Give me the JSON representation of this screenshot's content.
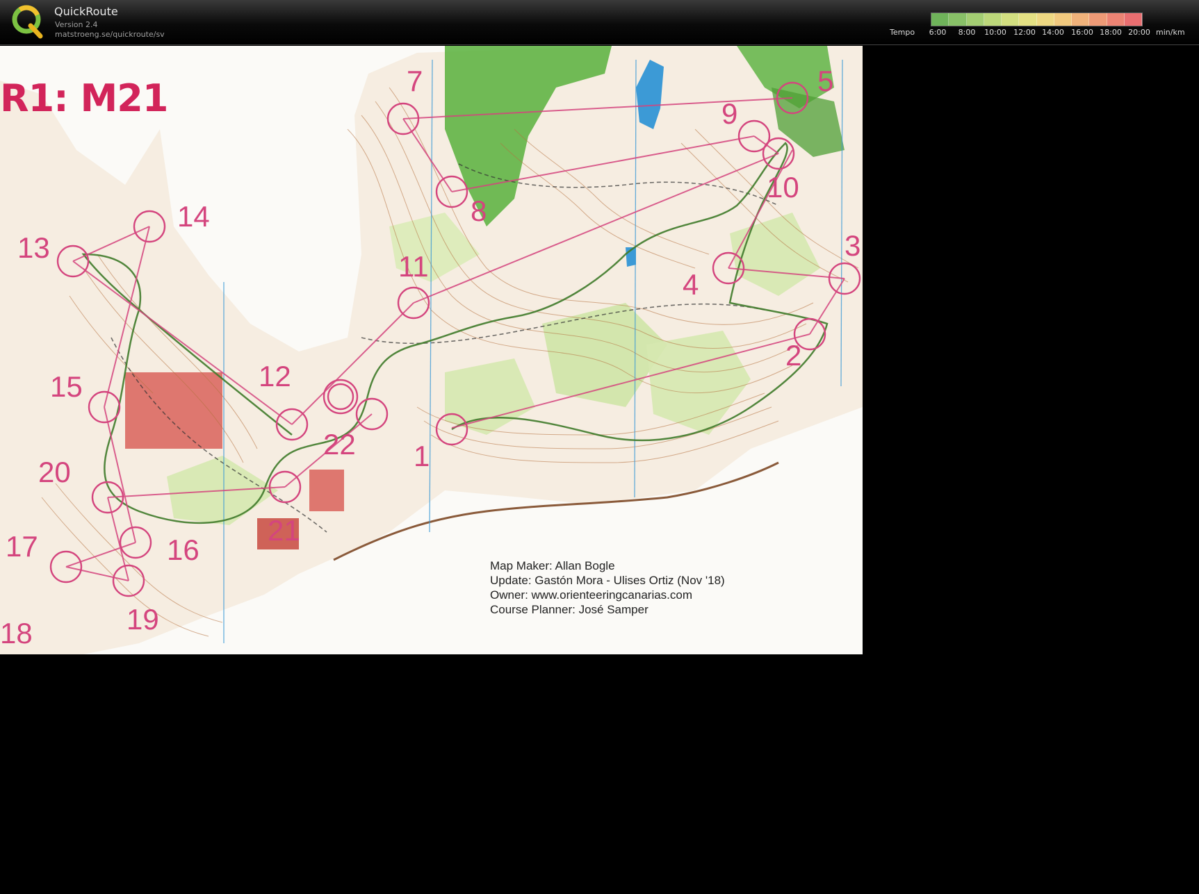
{
  "app": {
    "name": "QuickRoute",
    "version": "Version 2.4",
    "url": "matstroeng.se/quickroute/sv"
  },
  "tempo": {
    "label": "Tempo",
    "ticks": [
      "6:00",
      "8:00",
      "10:00",
      "12:00",
      "14:00",
      "16:00",
      "18:00",
      "20:00"
    ],
    "unit": "min/km",
    "colors": [
      "#6fb35a",
      "#88c067",
      "#a3cd72",
      "#bcd77a",
      "#d2df80",
      "#e4e083",
      "#eed882",
      "#f1c97e",
      "#f0b27a",
      "#ee9a76",
      "#ec8373",
      "#e96e70"
    ]
  },
  "map": {
    "title": "R1: M21",
    "credits": {
      "maker": "Map Maker: Allan Bogle",
      "update": "Update: Gastón Mora - Ulises Ortiz (Nov '18)",
      "owner": "Owner: www.orienteeringcanarias.com",
      "planner": "Course Planner: José Samper"
    },
    "controls": [
      "1",
      "2",
      "3",
      "4",
      "5",
      "7",
      "8",
      "9",
      "10",
      "11",
      "12",
      "13",
      "14",
      "15",
      "16",
      "17",
      "18",
      "19",
      "20",
      "21",
      "22"
    ],
    "colors": {
      "course": "#d4457e",
      "route": "#3f7a2a",
      "forest": "#58b03c",
      "contour": "#b5713f",
      "water": "#3c9ad6",
      "open": "#f3b86a",
      "building": "#c8493f"
    }
  }
}
